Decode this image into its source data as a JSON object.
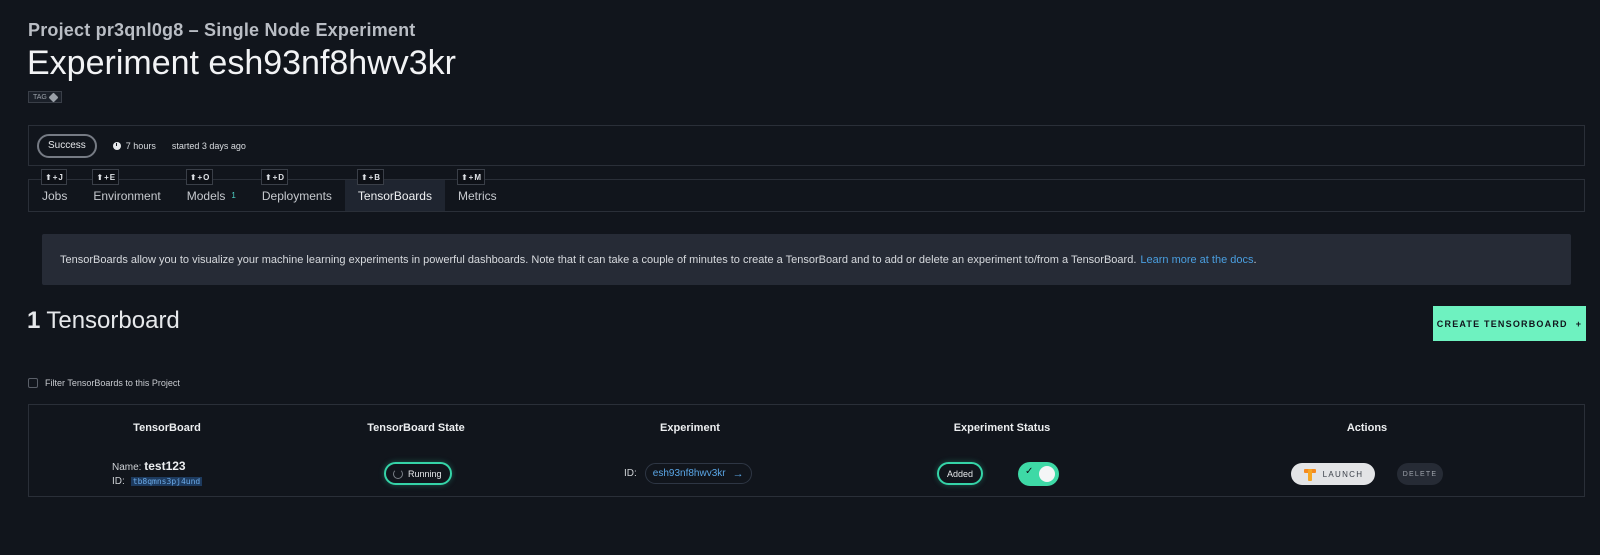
{
  "header": {
    "project_title": "Project pr3qnl0g8 – Single Node Experiment",
    "experiment_title": "Experiment esh93nf8hwv3kr",
    "tag_label": "TAG"
  },
  "status": {
    "state": "Success",
    "duration": "7 hours",
    "started": "started 3 days ago"
  },
  "tabs": [
    {
      "label": "Jobs",
      "shortcut": "J"
    },
    {
      "label": "Environment",
      "shortcut": "E"
    },
    {
      "label": "Models",
      "shortcut": "O",
      "badge": "1"
    },
    {
      "label": "Deployments",
      "shortcut": "D"
    },
    {
      "label": "TensorBoards",
      "shortcut": "B",
      "active": true
    },
    {
      "label": "Metrics",
      "shortcut": "M"
    }
  ],
  "info": {
    "text": "TensorBoards allow you to visualize your machine learning experiments in powerful dashboards. Note that it can take a couple of minutes to create a TensorBoard and to add or delete an experiment to/from a TensorBoard.",
    "link_text": "Learn more at the docs",
    "suffix": "."
  },
  "list": {
    "count": "1",
    "count_label": "Tensorboard",
    "create_button": "CREATE TENSORBOARD",
    "create_icon": "+",
    "filter_label": "Filter TensorBoards to this Project"
  },
  "table": {
    "headers": [
      "TensorBoard",
      "TensorBoard State",
      "Experiment",
      "Experiment Status",
      "Actions"
    ],
    "rows": [
      {
        "name_label": "Name:",
        "name": "test123",
        "id_label": "ID:",
        "id": "tb8qmns3pj4und",
        "state": "Running",
        "exp_id_label": "ID:",
        "exp_id": "esh93nf8hwv3kr",
        "exp_status": "Added",
        "launch_label": "LAUNCH",
        "delete_label": "DELETE"
      }
    ]
  },
  "colors": {
    "accent": "#6ef2c0",
    "link": "#4a9fe0",
    "background": "#11151c"
  }
}
